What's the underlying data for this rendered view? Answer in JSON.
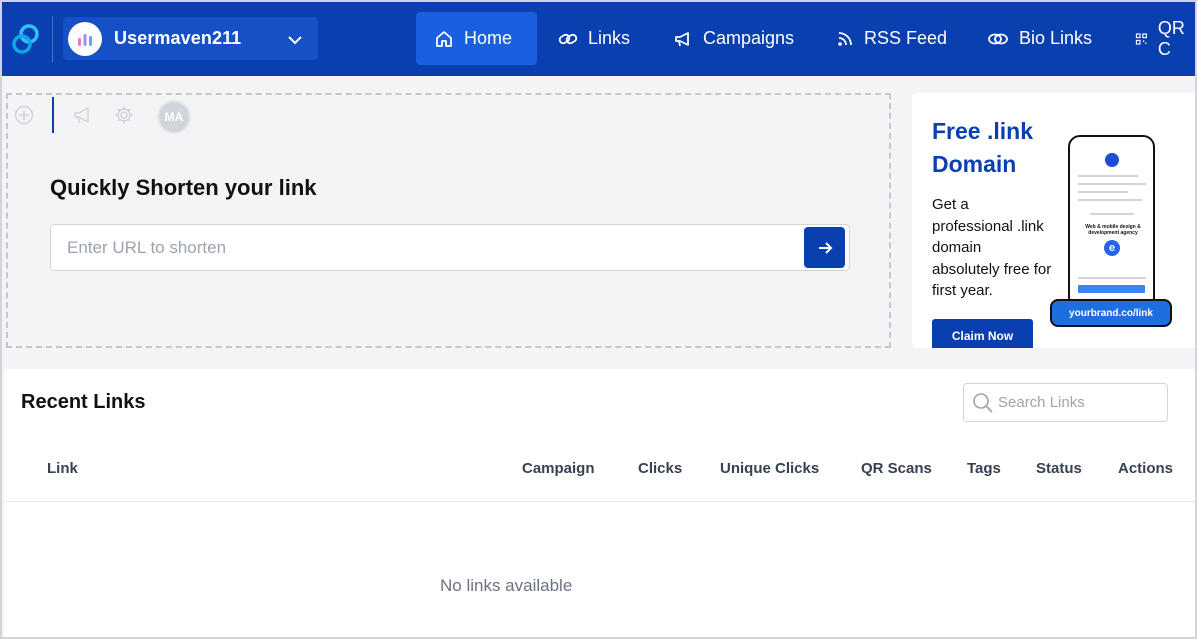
{
  "nav": {
    "workspace_name": "Usermaven211",
    "items": [
      {
        "label": "Home",
        "icon": "home-icon"
      },
      {
        "label": "Links",
        "icon": "link-icon"
      },
      {
        "label": "Campaigns",
        "icon": "megaphone-icon"
      },
      {
        "label": "RSS Feed",
        "icon": "rss-icon"
      },
      {
        "label": "Bio Links",
        "icon": "bio-link-icon"
      },
      {
        "label": "QR C",
        "icon": "qr-icon"
      }
    ],
    "colors": {
      "bar": "#0a3fb0",
      "active": "#1a5fe0"
    }
  },
  "shortener": {
    "avatar_initials": "MA",
    "title": "Quickly Shorten your link",
    "input_placeholder": "Enter URL to shorten"
  },
  "promo": {
    "title": "Free .link Domain",
    "description": "Get a professional .link domain absolutely free for first year.",
    "button_label": "Claim Now",
    "pill_text": "yourbrand.co/link",
    "phone_heading": "Web & mobile design & development agency"
  },
  "recent_links": {
    "title": "Recent Links",
    "search_placeholder": "Search Links",
    "columns": [
      "Link",
      "Campaign",
      "Clicks",
      "Unique Clicks",
      "QR Scans",
      "Tags",
      "Status",
      "Actions"
    ],
    "empty_message": "No links available"
  }
}
